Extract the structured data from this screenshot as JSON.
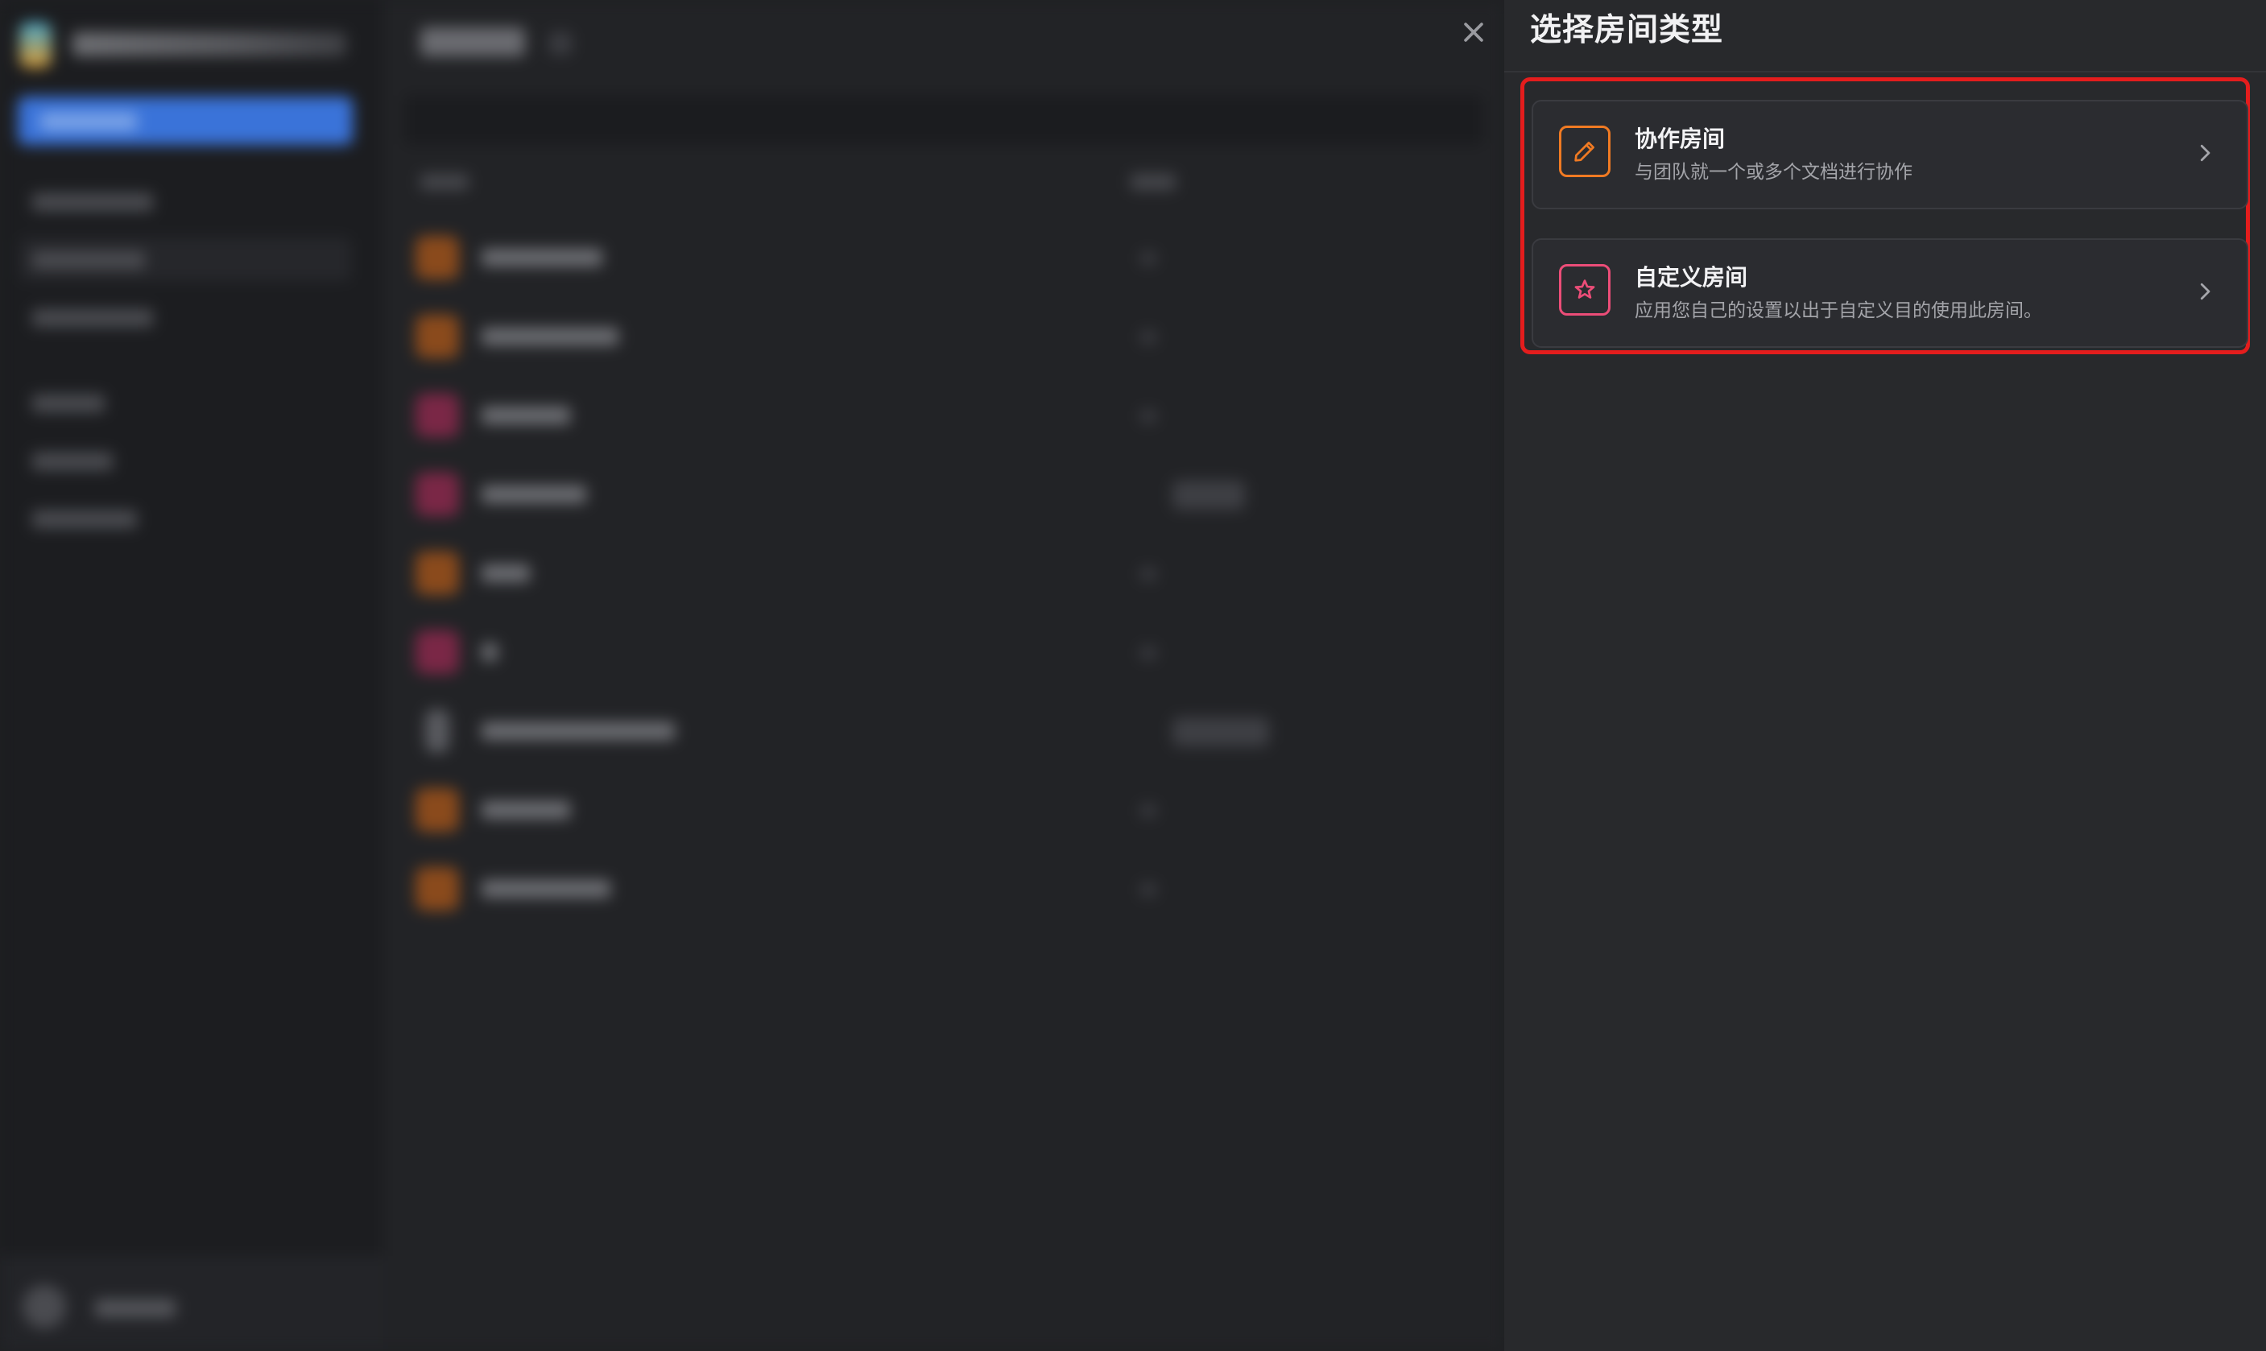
{
  "panel": {
    "title": "选择房间类型"
  },
  "room_types": [
    {
      "title": "协作房间",
      "description": "与团队就一个或多个文档进行协作",
      "icon": "pencil-icon",
      "color": "#f07a23"
    },
    {
      "title": "自定义房间",
      "description": "应用您自己的设置以出于自定义目的使用此房间。",
      "icon": "star-icon",
      "color": "#ec4d78"
    }
  ],
  "colors": {
    "highlight": "#e41d1d",
    "panel_bg": "#28292c",
    "card_bg": "#2b2c30"
  }
}
